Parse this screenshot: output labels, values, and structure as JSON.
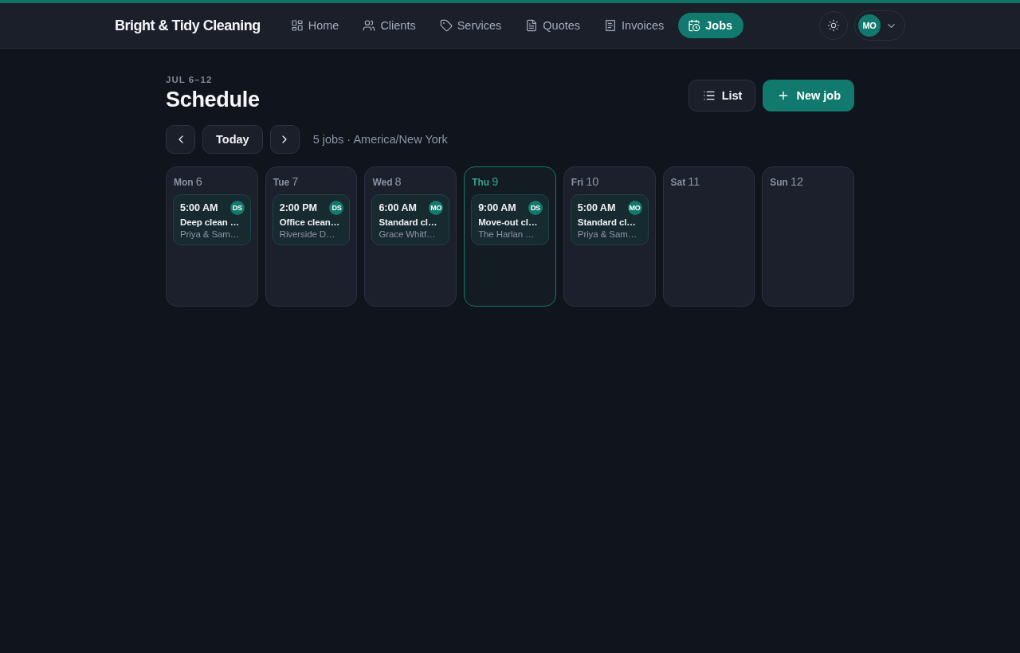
{
  "brand": "Bright & Tidy Cleaning",
  "nav": [
    {
      "label": "Home",
      "selected": false
    },
    {
      "label": "Clients",
      "selected": false
    },
    {
      "label": "Services",
      "selected": false
    },
    {
      "label": "Quotes",
      "selected": false
    },
    {
      "label": "Invoices",
      "selected": false
    },
    {
      "label": "Jobs",
      "selected": true
    }
  ],
  "user": {
    "initials": "MO"
  },
  "header": {
    "eyebrow": "JUL 6–12",
    "title": "Schedule"
  },
  "actions": [
    {
      "label": "List",
      "kind": "secondary"
    },
    {
      "label": "New job",
      "kind": "primary"
    }
  ],
  "week_nav": {
    "today_label": "Today",
    "summary": "5 jobs · America/New York"
  },
  "days": [
    {
      "weekday": "Mon",
      "date": "6",
      "today": false,
      "jobs": [
        {
          "time": "5:00 AM",
          "assignee": "DS",
          "title": "Deep clean …",
          "client": "Priya & Sam…"
        }
      ]
    },
    {
      "weekday": "Tue",
      "date": "7",
      "today": false,
      "jobs": [
        {
          "time": "2:00 PM",
          "assignee": "DS",
          "title": "Office clean…",
          "client": "Riverside D…"
        }
      ]
    },
    {
      "weekday": "Wed",
      "date": "8",
      "today": false,
      "jobs": [
        {
          "time": "6:00 AM",
          "assignee": "MO",
          "title": "Standard cl…",
          "client": "Grace Whitf…"
        }
      ]
    },
    {
      "weekday": "Thu",
      "date": "9",
      "today": true,
      "jobs": [
        {
          "time": "9:00 AM",
          "assignee": "DS",
          "title": "Move-out cl…",
          "client": "The Harlan …"
        }
      ]
    },
    {
      "weekday": "Fri",
      "date": "10",
      "today": false,
      "jobs": [
        {
          "time": "5:00 AM",
          "assignee": "MO",
          "title": "Standard cl…",
          "client": "Priya & Sam…"
        }
      ]
    },
    {
      "weekday": "Sat",
      "date": "11",
      "today": false
    },
    {
      "weekday": "Sun",
      "date": "12",
      "today": false
    }
  ]
}
